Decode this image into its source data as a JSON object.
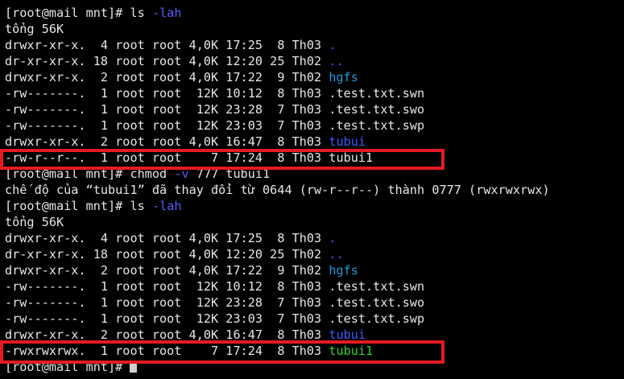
{
  "terminal": {
    "prompt": "[root@mail mnt]#",
    "cmd_ls": "ls",
    "cmd_ls_flag": "-lah",
    "total": "tổng 56K",
    "listing1": {
      "dot": "drwxr-xr-x.  4 root root 4,0K 17:25  8 Th03 ",
      "dot_name": ".",
      "dotdot": "dr-xr-xr-x. 18 root root 4,0K 12:20 25 Th02 ",
      "dotdot_name": "..",
      "hgfs": "drwxr-xr-x.  2 root root 4,0K 17:22  9 Th02 ",
      "hgfs_name": "hgfs",
      "swn": "-rw-------.  1 root root  12K 10:12  8 Th03 .test.txt.swn",
      "swo": "-rw-------.  1 root root  12K 23:28  7 Th03 .test.txt.swo",
      "swp": "-rw-------.  1 root root  12K 23:03  7 Th03 .test.txt.swp",
      "tubui": "drwxr-xr-x.  2 root root 4,0K 16:47  8 Th03 ",
      "tubui_name": "tubui",
      "tubui1": "-rw-r--r--.  1 root root    7 17:24  8 Th03 tubui1"
    },
    "cmd_chmod": "chmod",
    "cmd_chmod_flag": "-v",
    "cmd_chmod_args": "777 tubui1",
    "chmod_output": "chế độ của “tubui1” đã thay đổi từ 0644 (rw-r--r--) thành 0777 (rwxrwxrwx)",
    "listing2": {
      "dot": "drwxr-xr-x.  4 root root 4,0K 17:25  8 Th03 ",
      "dot_name": ".",
      "dotdot": "dr-xr-xr-x. 18 root root 4,0K 12:20 25 Th02 ",
      "dotdot_name": "..",
      "hgfs": "drwxr-xr-x.  2 root root 4,0K 17:22  9 Th02 ",
      "hgfs_name": "hgfs",
      "swn": "-rw-------.  1 root root  12K 10:12  8 Th03 .test.txt.swn",
      "swo": "-rw-------.  1 root root  12K 23:28  7 Th03 .test.txt.swo",
      "swp": "-rw-------.  1 root root  12K 23:03  7 Th03 .test.txt.swp",
      "tubui": "drwxr-xr-x.  2 root root 4,0K 16:47  8 Th03 ",
      "tubui_name": "tubui",
      "tubui1": "-rwxrwxrwx.  1 root root    7 17:24  8 Th03 ",
      "tubui1_name": "tubui1"
    },
    "colors": {
      "background": "#000000",
      "text": "#e6e6e6",
      "directory": "#3a5cff",
      "hgfs_dir": "#1e9bd7",
      "executable": "#2fd22f",
      "highlight_box": "#e41b23"
    }
  }
}
